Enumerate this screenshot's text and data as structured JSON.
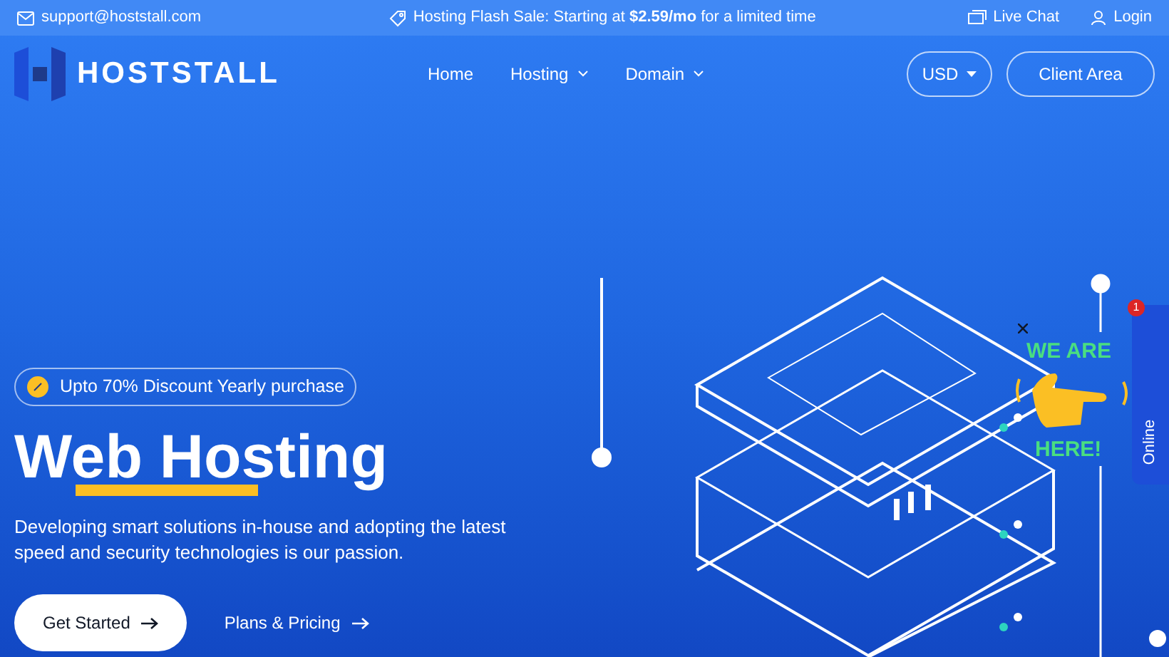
{
  "topbar": {
    "email": "support@hoststall.com",
    "promo": "Hosting Flash Sale: Starting at **$2.59/mo** for a limited time",
    "links": [
      {
        "kind": "chat",
        "label": "Live Chat"
      },
      {
        "kind": "user",
        "label": "Login"
      }
    ]
  },
  "header": {
    "logo": "HOSTSTALL",
    "nav": [
      {
        "label": "Home",
        "dropdown": false
      },
      {
        "label": "Hosting",
        "dropdown": true
      },
      {
        "label": "Domain",
        "dropdown": true
      }
    ],
    "currency": "USD",
    "cta": "Client Area"
  },
  "hero": {
    "badge": "Upto 70% Discount Yearly purchase",
    "title": "Web Hosting",
    "subtitle": "Developing smart solutions in-house and adopting the latest speed and security technologies is our passion.",
    "buttons": [
      {
        "kind": "primary",
        "label": "Get Started"
      },
      {
        "kind": "link",
        "label": "Plans & Pricing"
      }
    ]
  },
  "chat_widget": {
    "callout_top": "WE ARE",
    "callout_bottom": "HERE!",
    "tab": "Online",
    "unread": "1"
  }
}
